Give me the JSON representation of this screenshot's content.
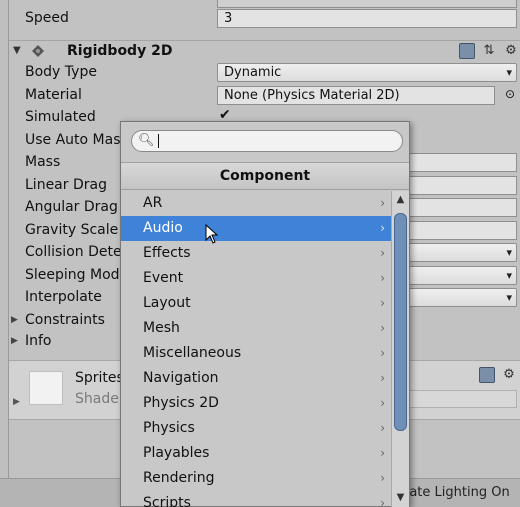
{
  "inspector": {
    "top_field": {
      "label": "Speed",
      "value": "3"
    },
    "rigidbody": {
      "title": "Rigidbody 2D",
      "body_type": {
        "label": "Body Type",
        "value": "Dynamic"
      },
      "material": {
        "label": "Material",
        "value": "None (Physics Material 2D)"
      },
      "simulated": {
        "label": "Simulated",
        "check": "✔"
      },
      "use_auto_mass": {
        "label": "Use Auto Mas"
      },
      "mass": {
        "label": "Mass"
      },
      "linear_drag": {
        "label": "Linear Drag"
      },
      "angular_drag": {
        "label": "Angular Drag"
      },
      "gravity_scale": {
        "label": "Gravity Scale"
      },
      "collision_detection": {
        "label": "Collision Detec"
      },
      "sleeping_mode": {
        "label": "Sleeping Mode"
      },
      "interpolate": {
        "label": "Interpolate"
      },
      "constraints": {
        "label": "Constraints"
      },
      "info": {
        "label": "Info"
      }
    },
    "sprite": {
      "name": "Sprites",
      "shader": "Shader"
    }
  },
  "bottom_bar": {
    "text": "rate Lighting On"
  },
  "popup": {
    "search": {
      "placeholder": "",
      "value": ""
    },
    "header": "Component",
    "items": [
      {
        "label": "AR"
      },
      {
        "label": "Audio"
      },
      {
        "label": "Effects"
      },
      {
        "label": "Event"
      },
      {
        "label": "Layout"
      },
      {
        "label": "Mesh"
      },
      {
        "label": "Miscellaneous"
      },
      {
        "label": "Navigation"
      },
      {
        "label": "Physics 2D"
      },
      {
        "label": "Physics"
      },
      {
        "label": "Playables"
      },
      {
        "label": "Rendering"
      },
      {
        "label": "Scripts"
      }
    ],
    "selected_item": "Audio"
  },
  "colors": {
    "selection": "#3f83d8",
    "scroll_thumb": "#6d8fb8"
  }
}
